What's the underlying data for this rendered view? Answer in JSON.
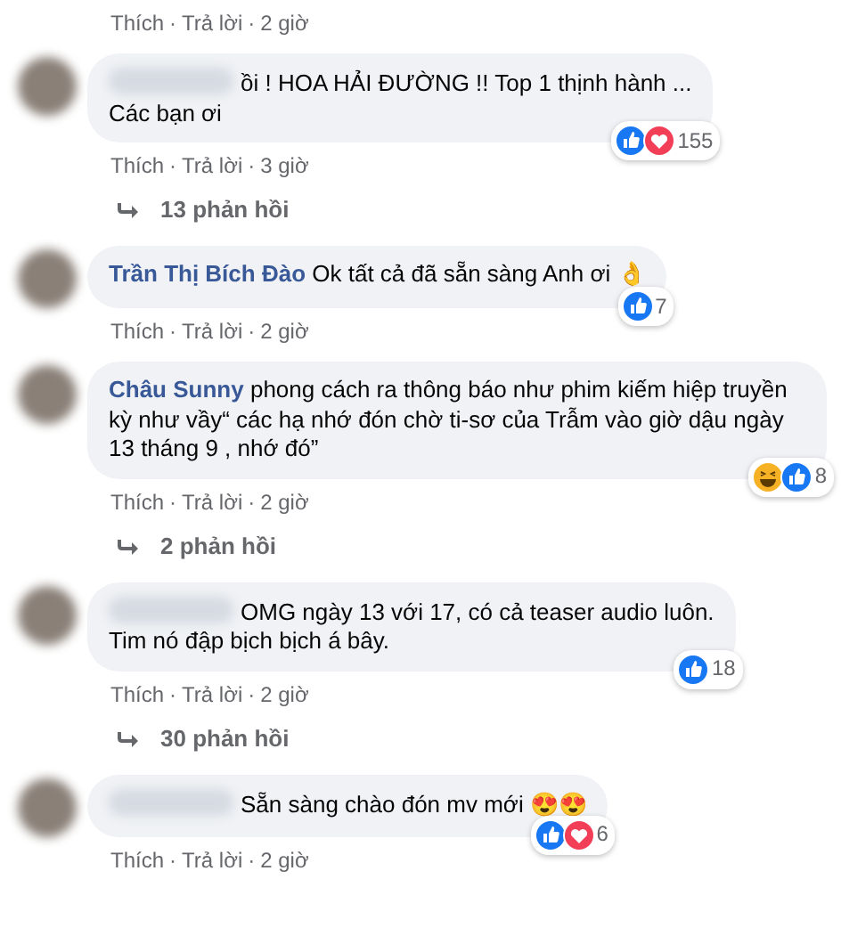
{
  "items": [
    {
      "kind": "actions",
      "like": "Thích",
      "sep": "·",
      "reply": "Trả lời",
      "time": "2 giờ"
    },
    {
      "kind": "comment",
      "text": "ồi ! HOA HẢI ĐƯỜNG !! Top 1 thịnh hành ...\nCác bạn ơi",
      "redacted": true,
      "reactions": [
        {
          "kind": "like"
        },
        {
          "kind": "love"
        }
      ],
      "count": "155",
      "like": "Thích",
      "sep": "·",
      "reply": "Trả lời",
      "time": "3 giờ"
    },
    {
      "kind": "replies",
      "label": "13 phản hồi"
    },
    {
      "kind": "comment",
      "author": "Trần Thị Bích Đào",
      "text": "Ok tất cả đã sẵn sàng Anh ơi 👌",
      "redacted": false,
      "reactions": [
        {
          "kind": "like"
        }
      ],
      "count": "7",
      "like": "Thích",
      "sep": "·",
      "reply": "Trả lời",
      "time": "2 giờ"
    },
    {
      "kind": "comment",
      "author": "Châu Sunny",
      "text": "phong cách ra thông báo như phim kiếm hiệp truyền kỳ như vầy“ các hạ nhớ đón chờ ti-sơ của Trẫm vào giờ dậu ngày 13 tháng 9 , nhớ đó”",
      "redacted": false,
      "reactions": [
        {
          "kind": "haha"
        },
        {
          "kind": "like"
        }
      ],
      "count": "8",
      "like": "Thích",
      "sep": "·",
      "reply": "Trả lời",
      "time": "2 giờ"
    },
    {
      "kind": "replies",
      "label": "2 phản hồi"
    },
    {
      "kind": "comment",
      "text": "OMG ngày 13 với 17, có cả teaser audio luôn.\nTim nó đập bịch bịch á bây.",
      "redacted": true,
      "reactions": [
        {
          "kind": "like"
        }
      ],
      "count": "18",
      "like": "Thích",
      "sep": "·",
      "reply": "Trả lời",
      "time": "2 giờ"
    },
    {
      "kind": "replies",
      "label": "30 phản hồi"
    },
    {
      "kind": "comment",
      "text": "Sẵn sàng chào đón mv mới 😍😍",
      "redacted": true,
      "reactions": [
        {
          "kind": "like"
        },
        {
          "kind": "love"
        }
      ],
      "count": "6",
      "like": "Thích",
      "sep": "·",
      "reply": "Trả lời",
      "time": "2 giờ"
    }
  ]
}
